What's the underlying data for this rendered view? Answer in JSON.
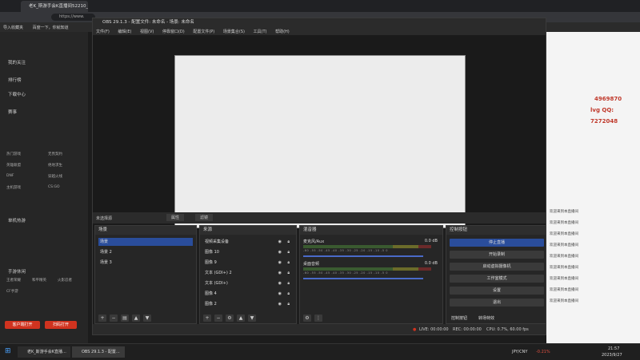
{
  "browser": {
    "tab_title": "老K_斯游手会K直播间52210_...",
    "url": "https://www.",
    "bookmarks": [
      "导入收藏夹",
      "百度一下，你就知道"
    ]
  },
  "site_left": {
    "nav": [
      "我的关注",
      "排行榜",
      "下载中心",
      "赛事"
    ],
    "categories_head": "单机热游",
    "grid": [
      "热门游戏",
      "无畏契约",
      "英雄联盟",
      "绝地求生",
      "DNF",
      "穿越火线",
      "主机游戏",
      "CS:GO"
    ],
    "mobile_head": "手游休闲",
    "mobile_grid": [
      "王者荣耀",
      "和平精英",
      "火影忍者",
      "CF手游"
    ],
    "btn_left": "客户端打开",
    "btn_right": "扫码打开"
  },
  "obs": {
    "title": "OBS 29.1.3 - 配置文件: 未命名 - 场景: 未命名",
    "menu": [
      "文件(F)",
      "编辑(E)",
      "视图(V)",
      "停靠窗口(D)",
      "配置文件(P)",
      "场景集合(S)",
      "工具(T)",
      "帮助(H)"
    ],
    "no_source_selected": "未选择源",
    "properties_btn": "属性",
    "filters_btn": "滤镜",
    "scenes": {
      "header": "场景",
      "items": [
        "场景",
        "场景 2",
        "场景 3"
      ]
    },
    "sources": {
      "header": "来源",
      "items": [
        "视频采集设备",
        "图像 10",
        "图像 9",
        "文本 (GDI+) 2",
        "文本 (GDI+)",
        "图像 4",
        "图像 2"
      ]
    },
    "mixer": {
      "header": "混音器",
      "channels": [
        {
          "name": "麦克风/Aux",
          "db": "0.0 dB"
        },
        {
          "name": "桌面音频",
          "db": "0.0 dB"
        }
      ],
      "ticks": "-60 -55 -50 -45 -40 -35 -30 -25 -20 -15 -10 -5 0"
    },
    "controls": {
      "header": "控制按钮",
      "buttons": [
        "停止直播",
        "开始录制",
        "启动虚拟摄像机",
        "工作室模式",
        "设置",
        "退出"
      ],
      "tabs": [
        "控制按钮",
        "转场特效"
      ]
    },
    "status": {
      "live": "LIVE: 00:00:00",
      "rec": "REC: 00:00:00",
      "cpu": "CPU: 0.7%, 60.00 fps"
    }
  },
  "site_right": {
    "chat": [
      "欢迎来到本直播间",
      "欢迎来到本直播间",
      "欢迎来到本直播间",
      "欢迎来到本直播间",
      "欢迎来到本直播间",
      "欢迎来到本直播间",
      "欢迎来到本直播间",
      "欢迎来到本直播间",
      "欢迎来到本直播间"
    ],
    "overlay_text": [
      "4969870",
      "lvg QQ:",
      "7272048"
    ]
  },
  "taskbar": {
    "task1": "老K_斯游手会K直播...",
    "task2": "OBS 29.1.3 - 配置...",
    "ticker": "JPY/CNY",
    "ticker_change": "-0.21%",
    "time": "21:57",
    "date": "2023/9/27"
  },
  "colors": {
    "accent_blue": "#2a4d9b",
    "live_red": "#d0331f"
  }
}
